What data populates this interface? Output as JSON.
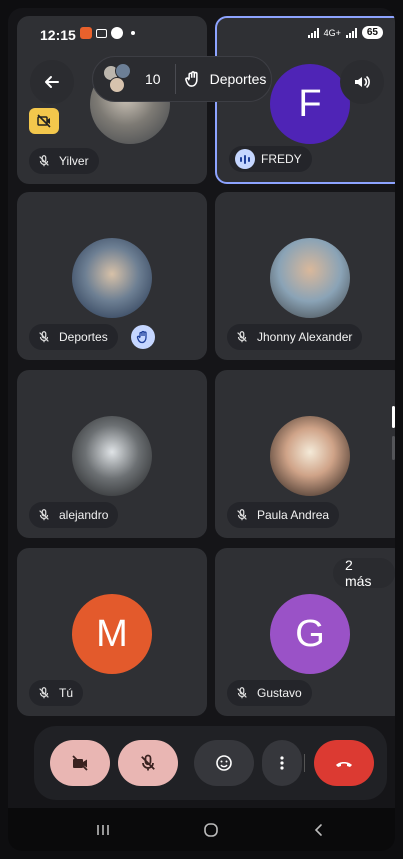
{
  "status_bar": {
    "time": "12:15",
    "network": "4G+",
    "battery": "65"
  },
  "top_bar": {
    "participant_count": "10",
    "raised_hand_name": "Deportes"
  },
  "tiles": [
    {
      "name": "Yilver",
      "mic": "muted",
      "camera": "off"
    },
    {
      "name": "FREDY",
      "initial": "F",
      "speaking": true,
      "active": true
    },
    {
      "name": "Deportes",
      "mic": "muted",
      "hand_raised": true
    },
    {
      "name": "Jhonny Alexander",
      "mic": "muted"
    },
    {
      "name": "alejandro",
      "mic": "muted"
    },
    {
      "name": "Paula Andrea",
      "mic": "muted"
    },
    {
      "name": "Tú",
      "initial": "M",
      "mic": "muted"
    },
    {
      "name": "Gustavo",
      "initial": "G",
      "mic": "muted"
    }
  ],
  "more_participants": "2 más",
  "controls": {
    "camera": "off",
    "microphone": "off"
  },
  "colors": {
    "tile_bg": "#2f3034",
    "accent_active": "#8da3ff",
    "end_call": "#dc3a32",
    "muted_control": "#e9b6b3"
  }
}
